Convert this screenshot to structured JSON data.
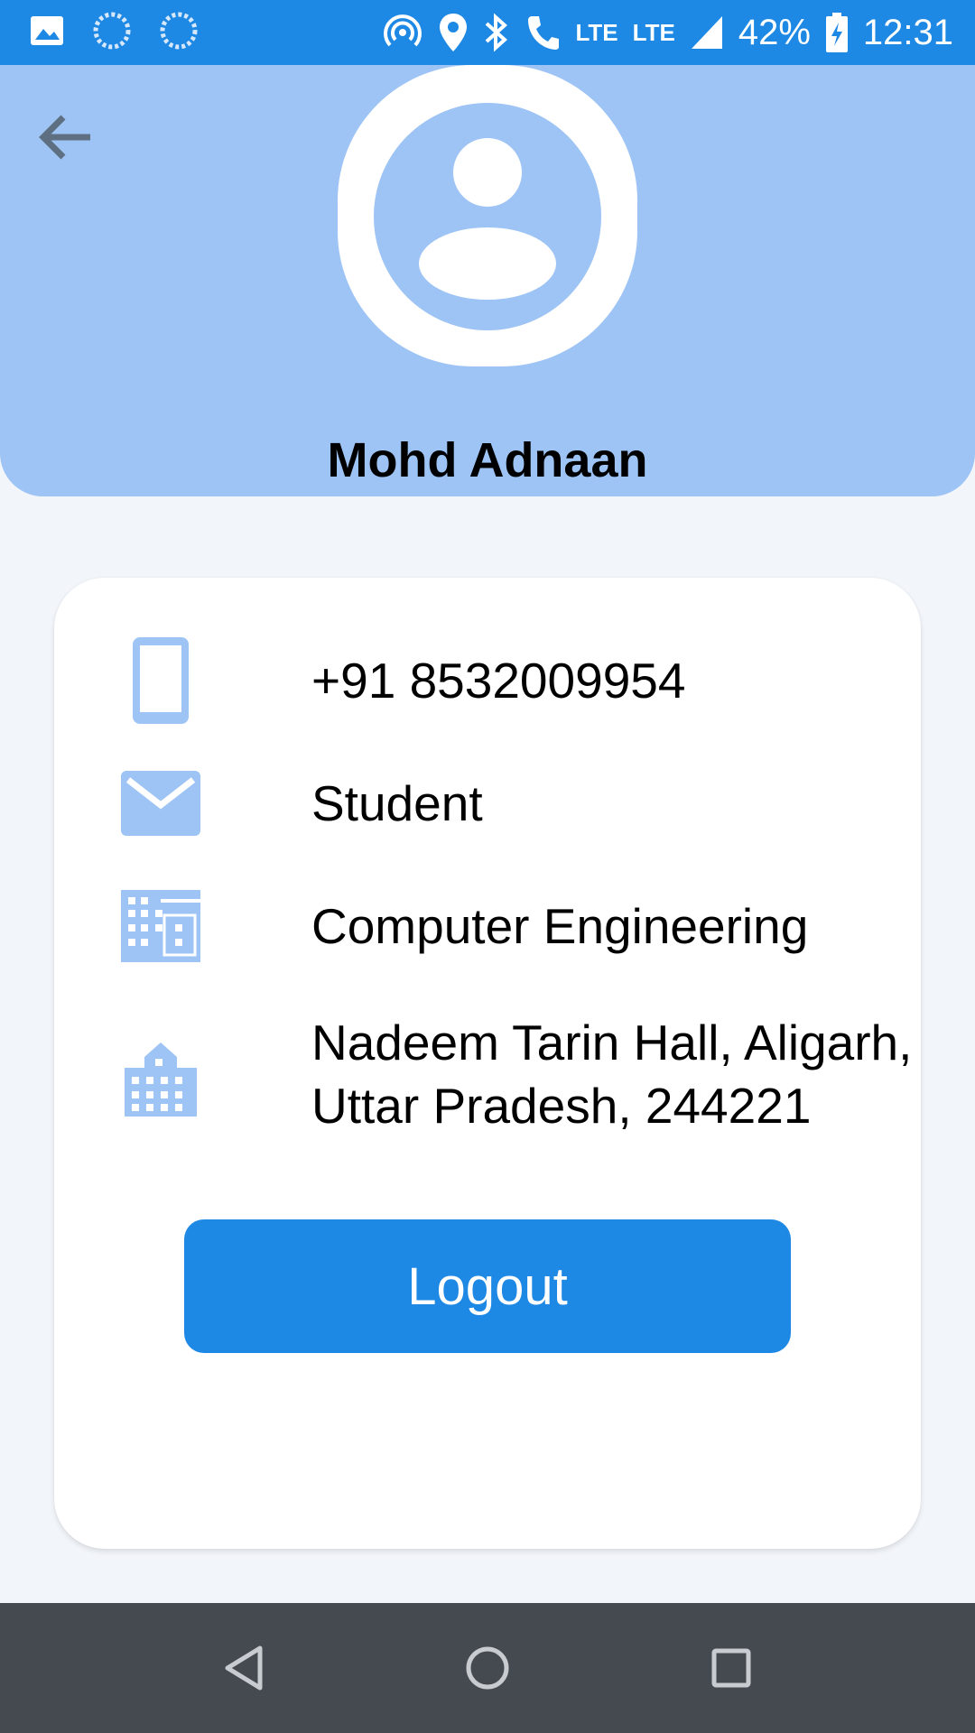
{
  "status_bar": {
    "lte_1": "LTE",
    "lte_2": "LTE",
    "battery": "42%",
    "time": "12:31"
  },
  "profile": {
    "name": "Mohd Adnaan"
  },
  "details": {
    "phone": "+91 8532009954",
    "role": "Student",
    "department": "Computer Engineering",
    "address_line1": "Nadeem Tarin Hall, Aligarh,",
    "address_line2": "Uttar Pradesh, 244221"
  },
  "actions": {
    "logout_label": "Logout"
  },
  "colors": {
    "primary": "#1e88e5",
    "header_bg": "#9dc4f5",
    "icon": "#9dc4f5",
    "nav_bar": "#454a50"
  },
  "icons": [
    "image-icon",
    "sync-icon",
    "hotspot-icon",
    "location-icon",
    "bluetooth-icon",
    "phone-icon",
    "signal-icon",
    "battery-icon",
    "back-arrow-icon",
    "avatar-icon",
    "mobile-phone-icon",
    "mail-icon",
    "business-icon",
    "apartment-icon",
    "nav-back-icon",
    "nav-home-icon",
    "nav-recents-icon"
  ]
}
